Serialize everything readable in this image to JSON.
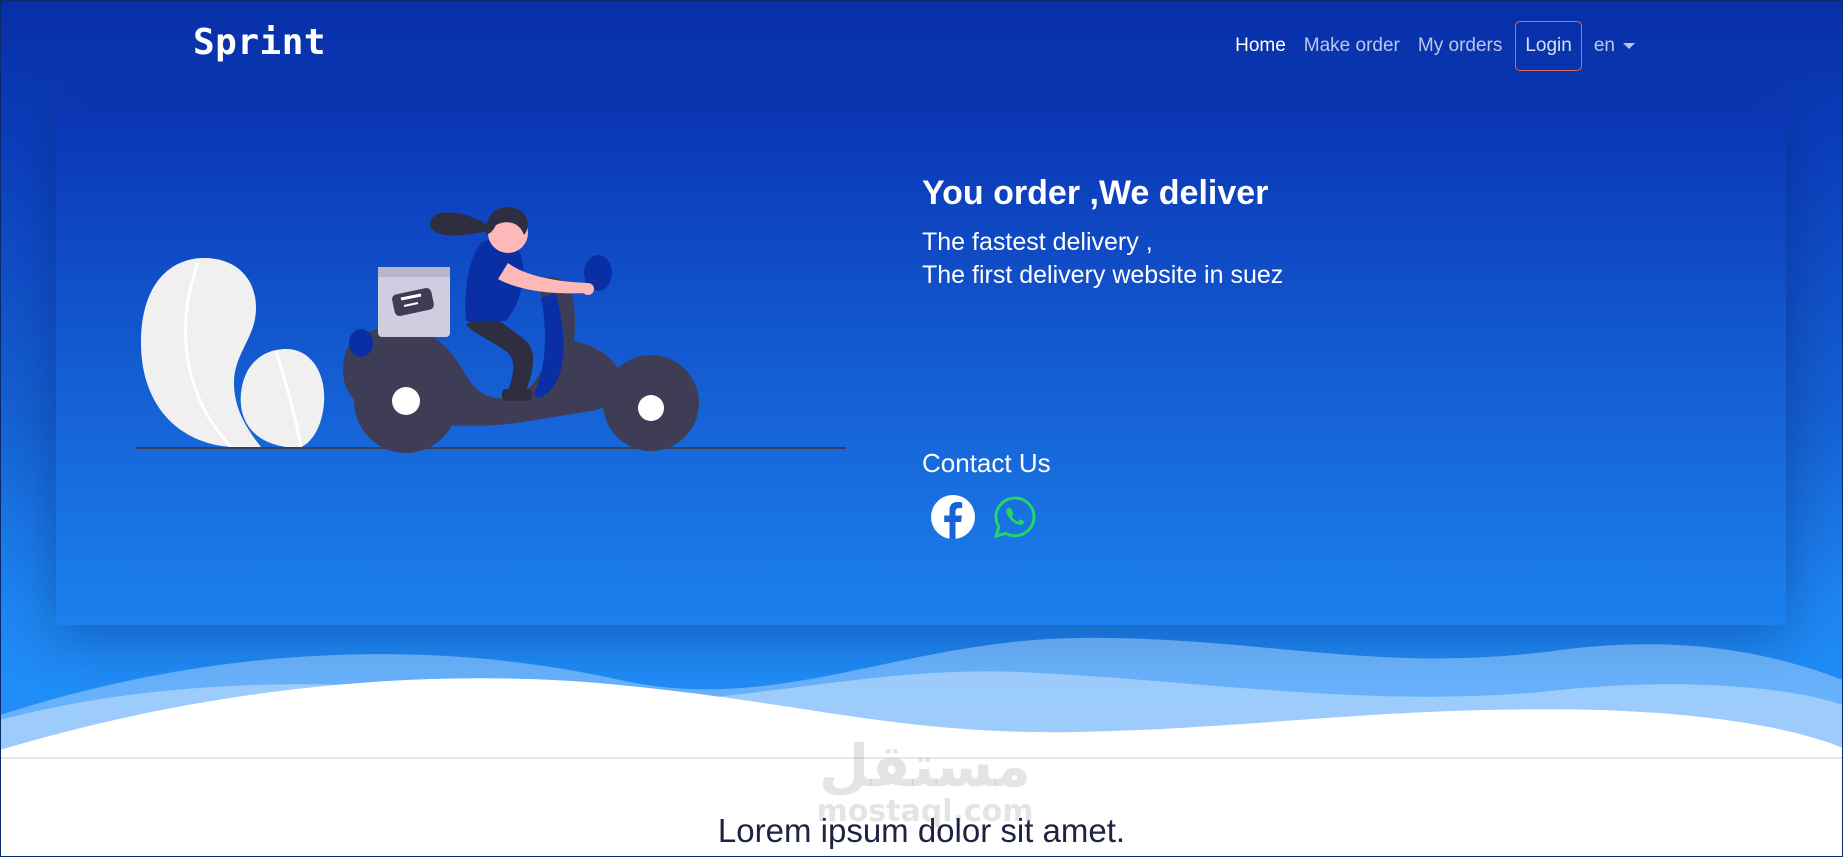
{
  "navbar": {
    "brand": "Sprint",
    "links": [
      "Home",
      "Make order",
      "My orders"
    ],
    "login_label": "Login",
    "language": "en"
  },
  "hero": {
    "headline": "You order ,We deliver",
    "subline1": "The fastest delivery ,",
    "subline2": "The first delivery website in suez",
    "contact_title": "Contact Us",
    "social_icons": [
      "facebook-icon",
      "whatsapp-icon"
    ]
  },
  "section": {
    "title": "Lorem ipsum dolor sit amet."
  },
  "watermark": {
    "arabic": "مستقل",
    "latin": "mostaql.com"
  },
  "colors": {
    "navy": "#072ea6",
    "blue": "#2392fb",
    "login_border": "#e0665a",
    "whatsapp": "#25d366",
    "scooter": "#3f3d56"
  }
}
